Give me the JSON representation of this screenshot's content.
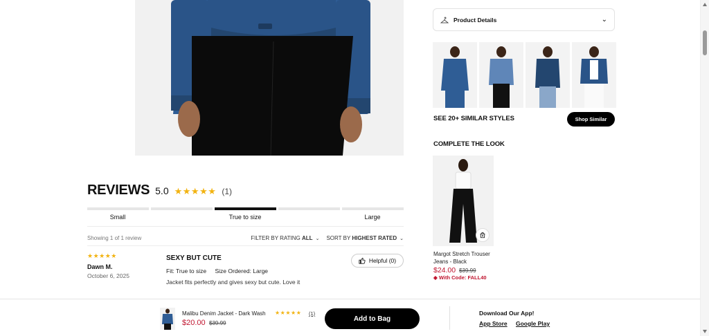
{
  "reviews": {
    "title": "REVIEWS",
    "score": "5.0",
    "stars": "★★★★★",
    "count": "(1)",
    "fit": {
      "labels": [
        "Small",
        "True to size",
        "Large"
      ],
      "selected_index": 2
    },
    "showing": "Showing 1 of 1 review",
    "filter": {
      "prefix": "FILTER BY RATING",
      "value": "ALL"
    },
    "sort": {
      "prefix": "SORT BY",
      "value": "HIGHEST RATED"
    },
    "items": [
      {
        "stars": "★★★★★",
        "name": "Dawn M.",
        "date": "October 6, 2025",
        "title": "SEXY BUT CUTE",
        "fit": "Fit: True to size",
        "size": "Size Ordered: Large",
        "body": "Jacket fits perfectly and gives sexy but cute. Love it",
        "helpful": "Helpful (0)"
      }
    ]
  },
  "product_details": {
    "label": "Product Details"
  },
  "similar": {
    "heading": "SEE 20+ SIMILAR STYLES",
    "button": "Shop Similar"
  },
  "complete_look": {
    "heading": "COMPLETE THE LOOK",
    "item": {
      "name": "Margot Stretch Trouser Jeans - Black",
      "price": "$24.00",
      "original_price": "$39.99",
      "code": "With Code: FALL40"
    }
  },
  "sticky_bar": {
    "name": "Malibu Denim Jacket - Dark Wash",
    "stars": "★★★★★",
    "count": "(1)",
    "price": "$20.00",
    "original_price": "$39.99",
    "button": "Add to Bag",
    "app_title": "Download Our App!",
    "app_store": "App Store",
    "google_play": "Google Play"
  },
  "colors": {
    "accent": "#c0152f",
    "star": "#f2b311",
    "denim": "#2f5d95",
    "denim_dark": "#23466f"
  }
}
